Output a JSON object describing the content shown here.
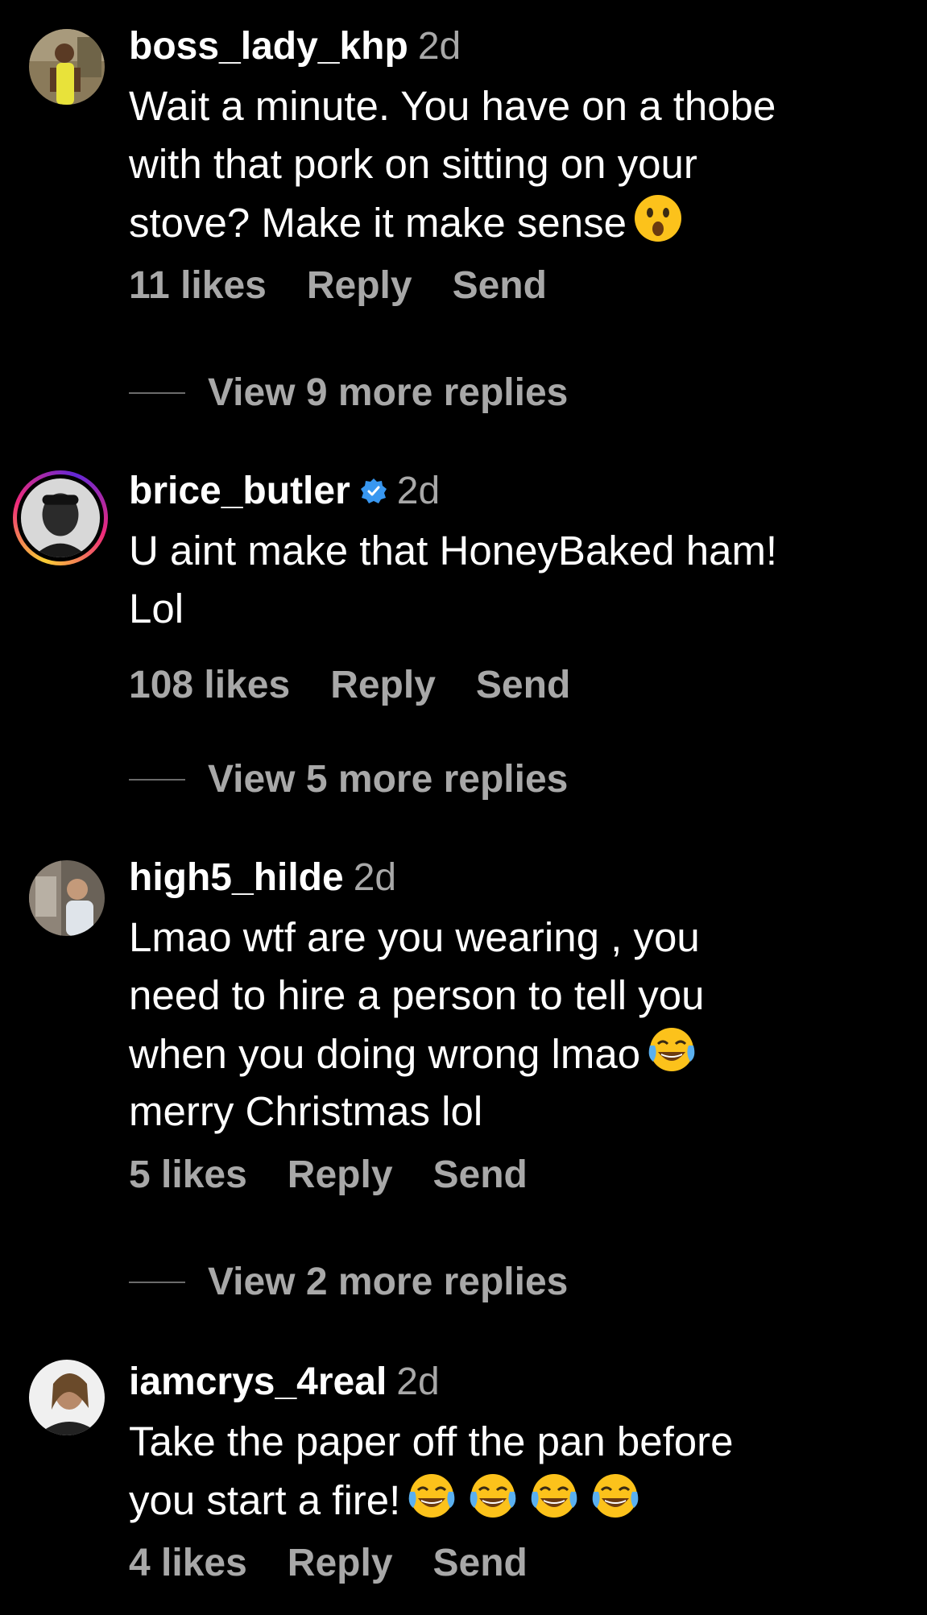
{
  "comments": [
    {
      "username": "boss_lady_khp",
      "time": "2d",
      "lines": [
        "Wait a minute. You have on a thobe",
        "with that pork on sitting on your",
        "stove?  Make it make sense"
      ],
      "likes": "11 likes",
      "reply": "Reply",
      "send": "Send",
      "more_replies": "View 9 more replies",
      "emoji": "hushed-face-icon"
    },
    {
      "username": "brice_butler",
      "verified": true,
      "time": "2d",
      "lines": [
        "U aint make that HoneyBaked ham!",
        "Lol"
      ],
      "likes": "108 likes",
      "reply": "Reply",
      "send": "Send",
      "more_replies": "View 5 more replies"
    },
    {
      "username": "high5_hilde",
      "time": "2d",
      "lines": [
        "Lmao wtf are you wearing , you",
        "need to hire a person to tell you",
        "when you doing wrong lmao",
        "merry Christmas lol"
      ],
      "likes": "5 likes",
      "reply": "Reply",
      "send": "Send",
      "more_replies": "View 2 more replies",
      "emoji": "tears-of-joy-icon"
    },
    {
      "username": "iamcrys_4real",
      "time": "2d",
      "lines": [
        "Take the paper off the pan before",
        "you start a fire!"
      ],
      "likes": "4 likes",
      "reply": "Reply",
      "send": "Send",
      "emoji": "tears-of-joy-icon x4"
    }
  ],
  "colors": {
    "background": "#000000",
    "text": "#ffffff",
    "secondary": "#a8a8a8",
    "verified": "#3897f0"
  }
}
